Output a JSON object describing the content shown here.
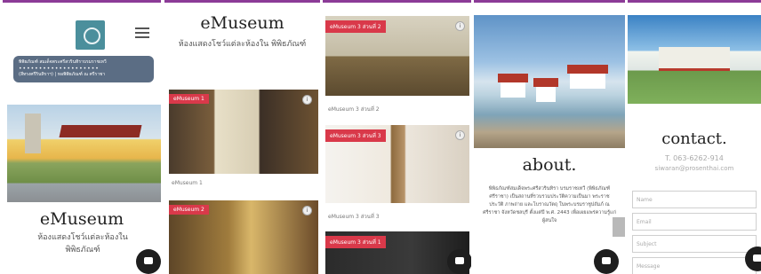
{
  "panel1": {
    "banner_line1": "พิพิธภัณฑ์ สมเด็จพระศรีสวรินทิราบรมราชเทวี",
    "banner_line2": "(สีทรงศรีรินทิราฯ) | หอพิพิธภัณฑ์ ณ ศรีราชา",
    "title": "eMuseum",
    "subtitle": "ห้องแสดงโชว์แต่ละห้องใน พิพิธภัณฑ์"
  },
  "panel2": {
    "title": "eMuseum",
    "subtitle": "ห้องแสดงโชว์แต่ละห้องใน พิพิธภัณฑ์",
    "card1_tag": "eMuseum 1",
    "card1_caption": "eMuseum 1",
    "card2_tag": "eMuseum 2"
  },
  "panel3": {
    "card1_tag": "eMuseum 3 ส่วนที่ 2",
    "card1_caption": "eMuseum 3 ส่วนที่ 2",
    "card2_tag": "eMuseum 3 ส่วนที่ 3",
    "card2_caption": "eMuseum 3 ส่วนที่ 3",
    "card3_tag": "eMuseum 3 ส่วนที่ 1"
  },
  "panel4": {
    "title": "about.",
    "body": "พิพิธภัณฑ์สมเด็จพระศรีสวรินทิรา บรมราชเทวี (พิพิธภัณฑ์ศรีราชา) เป็นสถานที่รวบรวมประวัติความเป็นมา พระราชประวัติ ภาพถ่าย และโบราณวัตถุ ในพระบรมราชูปถัมภ์ ณ ศรีราชา จังหวัดชลบุรี ตั้งแต่ปี พ.ศ. 2443 เพื่อเผยแพร่ความรู้แก่ผู้สนใจ"
  },
  "panel5": {
    "title": "contact.",
    "phone": "T. 063-6262-914",
    "email": "siwaran@prosenthai.com",
    "name_placeholder": "Name",
    "email_placeholder": "Email",
    "subject_placeholder": "Subject",
    "message_placeholder": "Message"
  },
  "colors": {
    "accent_purple": "#8c3b97",
    "tag_red": "#d9394a",
    "banner_slate": "#5b6d84"
  }
}
